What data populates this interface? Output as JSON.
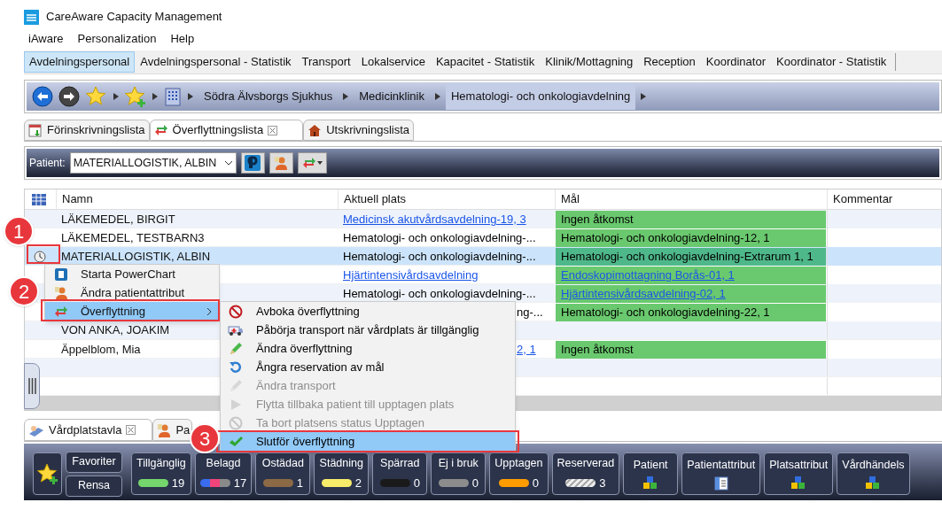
{
  "window": {
    "title": "CareAware Capacity Management"
  },
  "menu_bar": [
    "iAware",
    "Personalization",
    "Help"
  ],
  "perspective_tabs": [
    {
      "label": "Avdelningspersonal",
      "selected": true
    },
    {
      "label": "Avdelningspersonal - Statistik",
      "selected": false
    },
    {
      "label": "Transport",
      "selected": false
    },
    {
      "label": "Lokalservice",
      "selected": false
    },
    {
      "label": "Kapacitet - Statistik",
      "selected": false
    },
    {
      "label": "Klinik/Mottagning",
      "selected": false
    },
    {
      "label": "Reception",
      "selected": false
    },
    {
      "label": "Koordinator",
      "selected": false
    },
    {
      "label": "Koordinator - Statistik",
      "selected": false
    }
  ],
  "breadcrumb": [
    {
      "label": "Södra Älvsborgs Sjukhus",
      "selected": false
    },
    {
      "label": "Medicinklinik",
      "selected": false
    },
    {
      "label": "Hematologi- och onkologiavdelning",
      "selected": true
    }
  ],
  "view_tabs": [
    {
      "label": "Förinskrivningslista",
      "selected": false,
      "closable": false,
      "kind": "calendar"
    },
    {
      "label": "Överflyttningslista",
      "selected": true,
      "closable": true,
      "kind": "transfer"
    },
    {
      "label": "Utskrivningslista",
      "selected": false,
      "closable": false,
      "kind": "house"
    }
  ],
  "patient_toolbar": {
    "label": "Patient:",
    "value": "MATERIALLOGISTIK, ALBIN"
  },
  "table": {
    "columns": [
      "Namn",
      "Aktuell plats",
      "Mål",
      "Kommentar"
    ],
    "rows": [
      {
        "selected": false,
        "name": "LÄKEMEDEL, BIRGIT",
        "location": {
          "text": "Medicinsk akutvårdsavdelning-19, 3",
          "link": true
        },
        "target": {
          "text": "Ingen åtkomst",
          "link": false
        }
      },
      {
        "selected": false,
        "name": "LÄKEMEDEL, TESTBARN3",
        "location": {
          "text": "Hematologi- och onkologiavdelning-...",
          "link": false
        },
        "target": {
          "text": "Hematologi- och onkologiavdelning-12, 1",
          "link": false
        }
      },
      {
        "selected": true,
        "name": "MATERIALLOGISTIK, ALBIN",
        "location": {
          "text": "Hematologi- och onkologiavdelning-...",
          "link": false
        },
        "target": {
          "text": "Hematologi- och onkologiavdelning-Extrarum 1, 1",
          "link": false
        }
      },
      {
        "selected": false,
        "location": {
          "text": "Hjärtintensivårdsavdelning",
          "link": true
        },
        "target": {
          "text": "Endoskopimottagning Borås-01, 1",
          "link": true
        }
      },
      {
        "selected": false,
        "location": {
          "text": "Hematologi- och onkologiavdelning-...",
          "link": false
        },
        "target": {
          "text": "Hjärtintensivårdsavdelning-02, 1",
          "link": true
        }
      },
      {
        "selected": false,
        "location": {
          "text": "ng-...",
          "link": false,
          "covered": true
        },
        "target": {
          "text": "Hematologi- och onkologiavdelning-22, 1",
          "link": false
        }
      },
      {
        "selected": false,
        "name": "VON ANKA, JOAKIM"
      },
      {
        "selected": false,
        "name": "Äppelblom, Mia",
        "location": {
          "text": "2, 1",
          "link": true,
          "covered": true
        },
        "target": {
          "text": "Ingen åtkomst",
          "link": false
        }
      },
      {
        "selected": false
      },
      {
        "selected": false
      }
    ]
  },
  "context_menu": [
    {
      "label": "Starta PowerChart",
      "selected": false,
      "submenu": false,
      "kind": "powerchart"
    },
    {
      "label": "Ändra patientattribut",
      "selected": false,
      "submenu": false,
      "kind": "person"
    },
    {
      "label": "Överflyttning",
      "selected": true,
      "submenu": true,
      "kind": "transfer"
    }
  ],
  "submenu": [
    {
      "label": "Avboka överflyttning",
      "disabled": false,
      "selected": false,
      "kind": "prohibit"
    },
    {
      "label": "Påbörja transport när vårdplats är tillgänglig",
      "disabled": false,
      "selected": false,
      "kind": "ambulance"
    },
    {
      "label": "Ändra överflyttning",
      "disabled": false,
      "selected": false,
      "kind": "pencil"
    },
    {
      "label": "Ångra reservation av mål",
      "disabled": false,
      "selected": false,
      "kind": "undo"
    },
    {
      "label": "Ändra transport",
      "disabled": true,
      "selected": false,
      "kind": "pencil"
    },
    {
      "label": "Flytta tillbaka patient till upptagen plats",
      "disabled": true,
      "selected": false,
      "kind": "play"
    },
    {
      "label": "Ta bort platsens status Upptagen",
      "disabled": true,
      "selected": false,
      "kind": "prohibit"
    },
    {
      "label": "Slutför överflyttning",
      "disabled": false,
      "selected": true,
      "kind": "check"
    }
  ],
  "callouts": [
    "1",
    "2",
    "3"
  ],
  "bottom_tabs": [
    {
      "label": "Vårdplatstavla",
      "selected": true,
      "closable": true,
      "kind": "bed"
    },
    {
      "label": "Pa",
      "selected": false,
      "closable": false,
      "kind": "person"
    }
  ],
  "status_board": {
    "buttons": [
      "Favoriter",
      "Rensa"
    ],
    "tiles": [
      {
        "label": "Tillgänglig",
        "kind": "pill",
        "color": "#74d66c",
        "count": "19"
      },
      {
        "label": "Belagd",
        "kind": "multi",
        "count": "17"
      },
      {
        "label": "Ostädad",
        "kind": "pill",
        "color": "#8b6a45",
        "count": "1"
      },
      {
        "label": "Städning",
        "kind": "pill",
        "color": "#f6ec6a",
        "count": "2"
      },
      {
        "label": "Spärrad",
        "kind": "pill",
        "color": "#1a1a1a",
        "count": "0"
      },
      {
        "label": "Ej i bruk",
        "kind": "pill",
        "color": "#8c8c8c",
        "count": "0"
      },
      {
        "label": "Upptagen",
        "kind": "pill",
        "color": "#ff9c00",
        "count": "0"
      },
      {
        "label": "Reserverad",
        "kind": "striped",
        "count": "3"
      },
      {
        "label": "Patient",
        "kind": "cubes"
      },
      {
        "label": "Patientattribut",
        "kind": "list"
      },
      {
        "label": "Platsattribut",
        "kind": "cubes"
      },
      {
        "label": "Vårdhändels",
        "kind": "cubes"
      }
    ]
  }
}
